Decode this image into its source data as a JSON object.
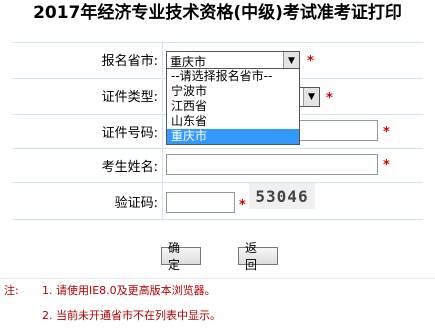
{
  "title": "2017年经济专业技术资格(中级)考试准考证打印",
  "form": {
    "province_label": "报名省市:",
    "province_value": "重庆市",
    "cert_type_label": "证件类型:",
    "cert_number_label": "证件号码:",
    "name_label": "考生姓名:",
    "captcha_label": "验证码:",
    "required_mark": "*",
    "captcha_text": "53046"
  },
  "dropdown": {
    "options": [
      "--请选择报名省市--",
      "宁波市",
      "江西省",
      "山东省",
      "重庆市"
    ],
    "selected_index": 4
  },
  "buttons": {
    "confirm": "确 定",
    "back": "返 回"
  },
  "notes": {
    "prefix": "注:",
    "line1": "1. 请使用IE8.0及更高版本浏览器。",
    "line2": "2. 当前未开通省市不在列表中显示。"
  }
}
